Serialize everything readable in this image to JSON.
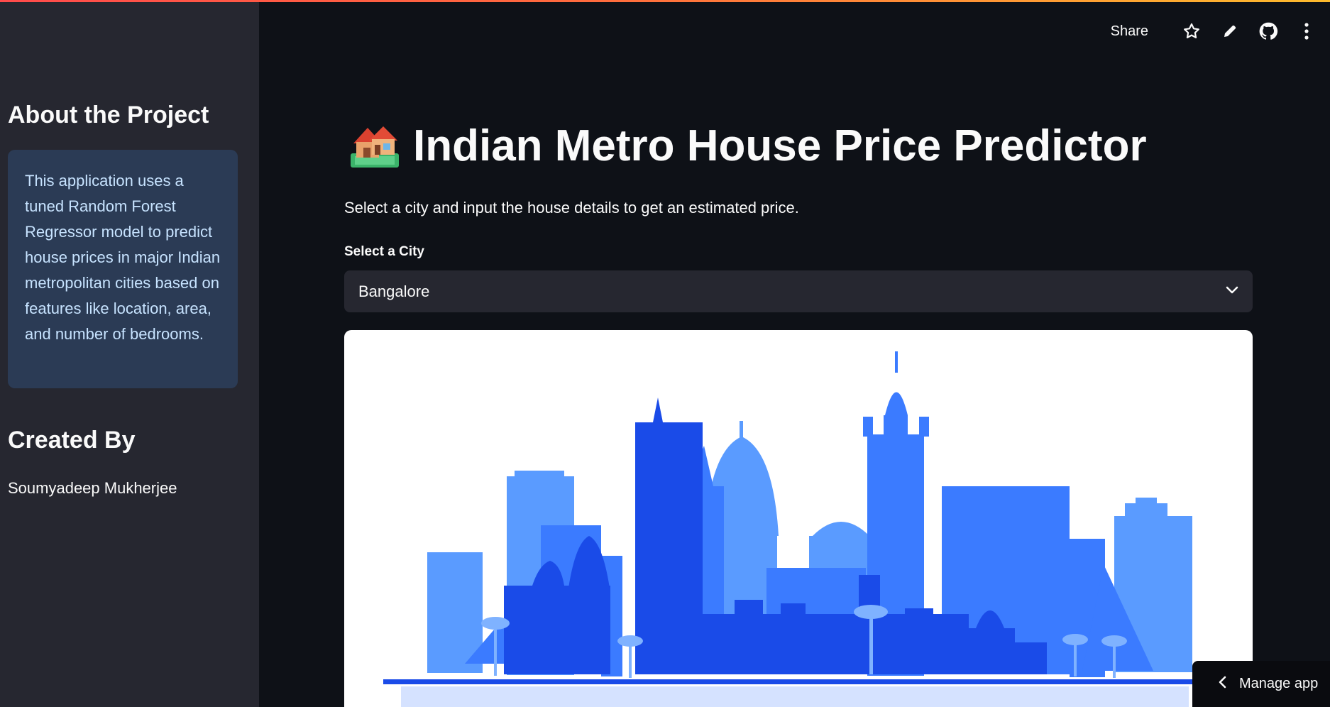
{
  "sidebar": {
    "about_heading": "About the Project",
    "about_text": "This application uses a tuned Random Forest Regressor model to predict house prices in major Indian metropolitan cities based on features like location, area, and number of bedrooms.",
    "created_heading": "Created By",
    "author": "Soumyadeep Mukherjee"
  },
  "header": {
    "share_label": "Share",
    "icons": [
      "star-icon",
      "pencil-icon",
      "github-icon",
      "more-vertical-icon"
    ]
  },
  "main": {
    "title": "Indian Metro House Price Predictor",
    "title_icon": "houses-emoji-icon",
    "subtitle": "Select a city and input the house details to get an estimated price.",
    "city_select": {
      "label": "Select a City",
      "value": "Bangalore"
    },
    "image_icon": "bangalore-skyline-illustration"
  },
  "footer": {
    "manage_label": "Manage app"
  },
  "colors": {
    "background": "#0e1117",
    "sidebar": "#262730",
    "info_box": "#2b3b55",
    "info_text": "#c7e3ff",
    "accent_gradient_start": "#ff4b4b",
    "accent_gradient_end": "#fdbb2d"
  }
}
